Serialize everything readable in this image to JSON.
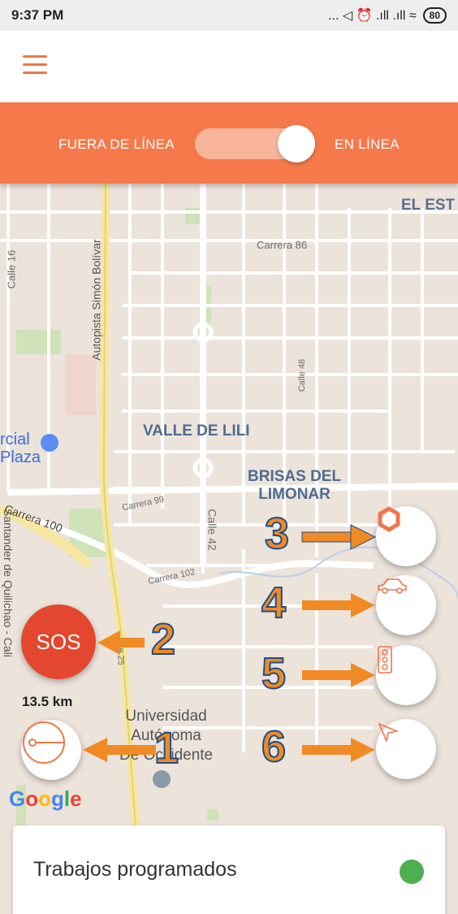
{
  "status_bar": {
    "time": "9:37 PM",
    "icons_text": "... ◁ ⏰ .ıll .ıll ≈",
    "battery": "80"
  },
  "app_bar": {
    "menu_icon": "hamburger-menu-icon"
  },
  "toggle": {
    "offline_label": "FUERA DE LÍNEA",
    "online_label": "EN LÍNEA",
    "state": "online"
  },
  "map": {
    "labels": {
      "el_est": "EL EST",
      "carrera86": "Carrera 86",
      "calle16": "Calle 16",
      "autopista": "Autopista Simón Bolívar",
      "calle48": "Calle 48",
      "valle": "VALLE DE LILI",
      "brisas1": "BRISAS DEL",
      "brisas2": "LIMONAR",
      "comercial1": "rcial",
      "comercial2": "Plaza",
      "santander": "Santander de Quilichao - Cali",
      "carrera99": "Carrera 99",
      "carrera100": "Carrera 100",
      "calle42": "Calle 42",
      "carrera102": "Carrera 102",
      "calle25": "e 25",
      "univ1": "Universidad",
      "univ2": "Autónoma",
      "univ3": "De Occidente"
    },
    "google_logo": "Google"
  },
  "controls": {
    "sos_label": "SOS",
    "distance": "13.5 km",
    "buttons": [
      {
        "icon": "hexagon-icon",
        "number": "3"
      },
      {
        "icon": "car-icon",
        "number": "4"
      },
      {
        "icon": "traffic-light-icon",
        "number": "5"
      },
      {
        "icon": "navigation-arrow-icon",
        "number": "6"
      }
    ],
    "radar_number": "1",
    "sos_number": "2"
  },
  "card": {
    "title": "Trabajos programados",
    "status_color": "#4caf50"
  },
  "colors": {
    "accent": "#f5794b",
    "sos": "#e3472f",
    "annotation": "#f08a24"
  }
}
